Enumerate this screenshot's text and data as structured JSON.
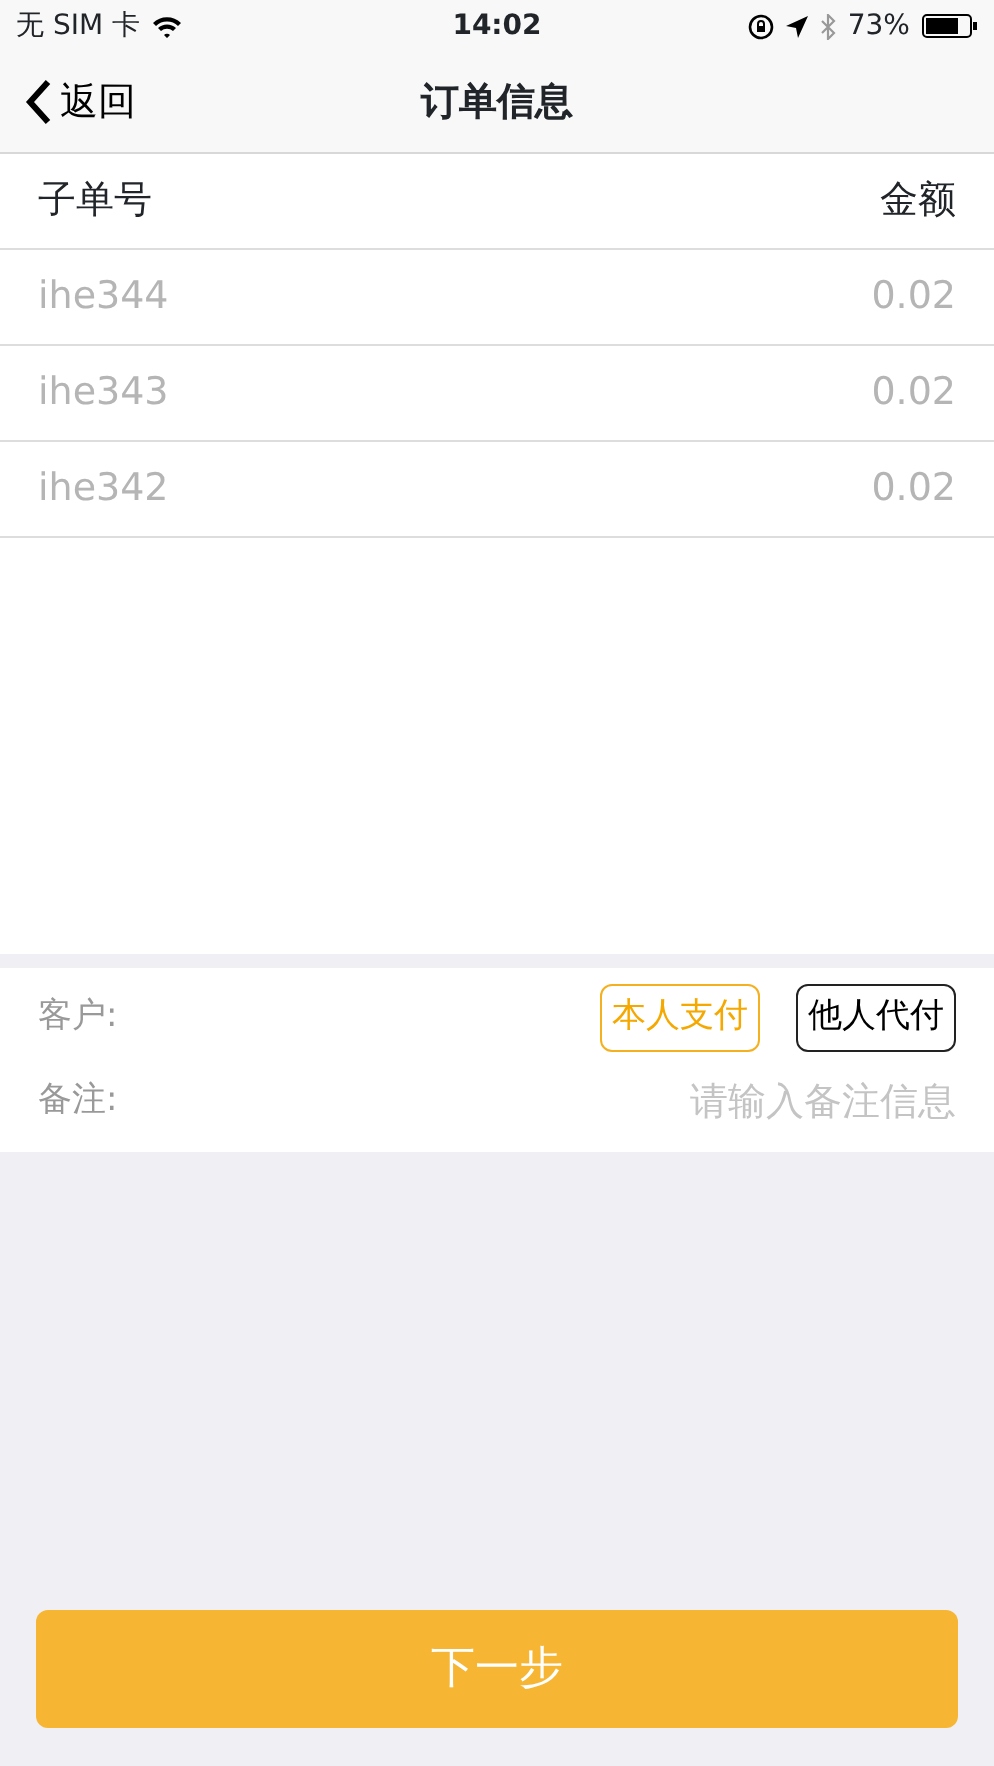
{
  "status_bar": {
    "carrier": "无 SIM 卡",
    "time": "14:02",
    "battery": "73%"
  },
  "nav": {
    "back": "返回",
    "title": "订单信息"
  },
  "table": {
    "columns": [
      "子单号",
      "金额"
    ],
    "rows": [
      {
        "id": "ihe344",
        "amount": "0.02"
      },
      {
        "id": "ihe343",
        "amount": "0.02"
      },
      {
        "id": "ihe342",
        "amount": "0.02"
      }
    ]
  },
  "customer": {
    "label": "客户:",
    "options": [
      {
        "label": "本人支付",
        "selected": true
      },
      {
        "label": "他人代付",
        "selected": false
      }
    ]
  },
  "note": {
    "label": "备注:",
    "placeholder": "请输入备注信息"
  },
  "next_button": "下一步"
}
